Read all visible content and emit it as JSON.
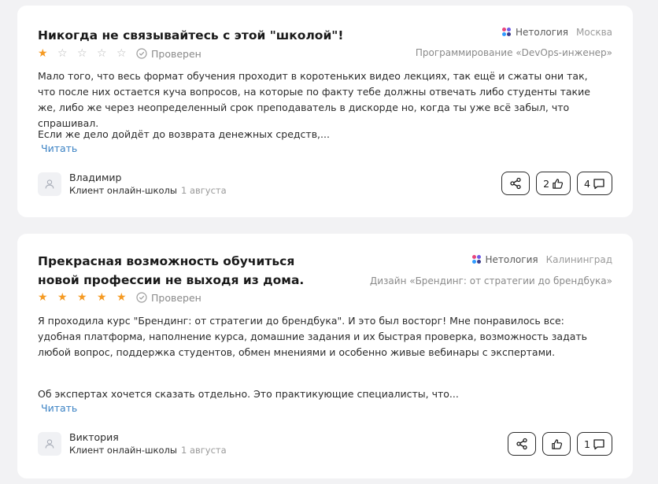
{
  "reviews": [
    {
      "title": "Никогда не связывайтесь с этой \"школой\"!",
      "rating": 1,
      "verified_label": "Проверен",
      "school": "Нетология",
      "city": "Москва",
      "course": "Программирование «DevOps-инженер»",
      "paragraph1": "Мало того, что весь формат обучения проходит в коротеньких видео лекциях, так ещё и сжаты они так, что после них остается куча вопросов, на которые по факту тебе должны отвечать либо студенты такие же, либо же через неопределенный срок преподаватель в дискорде но, когда ты уже всё забыл, что спрашивал.",
      "paragraph2": "Если же дело дойдёт до возврата денежных средств,...",
      "read_label": "Читать",
      "author_name": "Владимир",
      "author_role": "Клиент онлайн-школы",
      "date": "1 августа",
      "likes": "2",
      "comments": "4"
    },
    {
      "title": "Прекрасная возможность обучиться новой профессии не выходя из дома.",
      "rating": 5,
      "verified_label": "Проверен",
      "school": "Нетология",
      "city": "Калининград",
      "course": "Дизайн «Брендинг: от стратегии до брендбука»",
      "paragraph1": "Я проходила курс \"Брендинг: от стратегии до брендбука\". И это был восторг! Мне понравилось все: удобная платформа, наполнение курса, домашние задания и их быстрая проверка, возможность задать любой вопрос, поддержка студентов, обмен мнениями и особенно живые вебинары с экспертами.",
      "paragraph2": "Об экспертах хочется сказать отдельно. Это практикующие специалисты, что...",
      "read_label": "Читать",
      "author_name": "Виктория",
      "author_role": "Клиент онлайн-школы",
      "date": "1 августа",
      "likes": "",
      "comments": "1"
    }
  ],
  "icons": {
    "star": "star-icon",
    "verified": "shield-check-icon",
    "share": "share-icon",
    "like": "thumbs-up-icon",
    "comment": "comment-icon",
    "avatar": "user-icon"
  },
  "colors": {
    "star_active": "#f59a23",
    "star_inactive": "#b8b8b8",
    "link": "#3b82c4",
    "background": "#f2f2f4"
  }
}
